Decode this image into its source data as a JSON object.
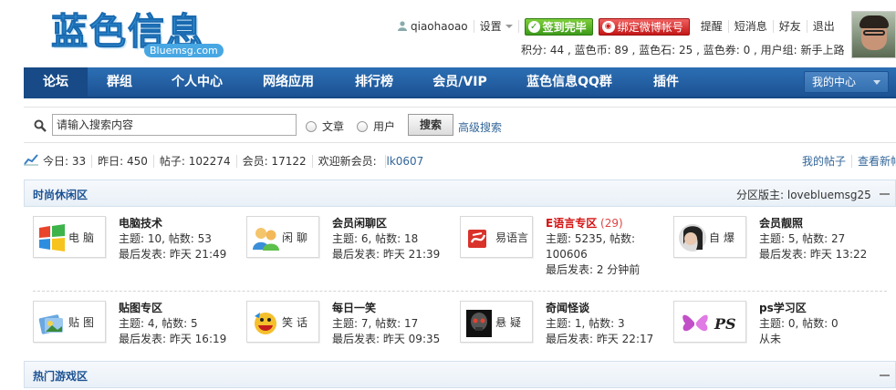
{
  "logo": {
    "text": "蓝色信息",
    "sub": "Bluemsg.com"
  },
  "userbar": {
    "username": "qiaohaoao",
    "settings": "设置",
    "sign_label": "签到完毕",
    "weibo_label": "绑定微博帐号",
    "remind": "提醒",
    "messages": "短消息",
    "friends": "好友",
    "logout": "退出"
  },
  "credits": "积分: 44 , 蓝色币: 89 , 蓝色石: 25 , 蓝色券: 0 , 用户组: 新手上路",
  "nav": {
    "items": [
      "论坛",
      "群组",
      "个人中心",
      "网络应用",
      "排行榜",
      "会员/VIP",
      "蓝色信息QQ群",
      "插件"
    ],
    "my_center": "我的中心"
  },
  "search": {
    "placeholder": "请输入搜索内容",
    "opt_article": "文章",
    "opt_user": "用户",
    "button": "搜索",
    "advanced": "高级搜索"
  },
  "stats": {
    "today": "今日: 33",
    "yesterday": "昨日: 450",
    "posts": "帖子: 102274",
    "members": "会员: 17122",
    "welcome_prefix": "欢迎新会员: ",
    "newest": "lk0607",
    "my_posts": "我的帖子",
    "view_new": "查看新帖"
  },
  "sections": [
    {
      "title": "时尚休闲区",
      "moderator": "分区版主: lovebluemsg25",
      "forums": [
        {
          "icon_label": "电脑",
          "icon": "windows-icon",
          "name": "电脑技术",
          "count": "",
          "topics": "主题: 10, 帖数: 53",
          "last": "最后发表: 昨天 21:49"
        },
        {
          "icon_label": "闲聊",
          "icon": "chat-people-icon",
          "name": "会员闲聊区",
          "count": "",
          "topics": "主题: 6, 帖数: 18",
          "last": "最后发表: 昨天 21:39"
        },
        {
          "icon_label": "易语言",
          "icon": "e-language-icon",
          "name": "E语言专区",
          "count": "(29)",
          "topics": "主题: 5235, 帖数: 100606",
          "last": "最后发表: 2 分钟前"
        },
        {
          "icon_label": "自爆",
          "icon": "portrait-icon",
          "name": "会员靓照",
          "count": "",
          "topics": "主题: 5, 帖数: 27",
          "last": "最后发表: 昨天 13:22"
        },
        {
          "icon_label": "贴图",
          "icon": "photo-icon",
          "name": "贴图专区",
          "count": "",
          "topics": "主题: 4, 帖数: 5",
          "last": "最后发表: 昨天 16:19"
        },
        {
          "icon_label": "笑话",
          "icon": "laugh-icon",
          "name": "每日一笑",
          "count": "",
          "topics": "主题: 7, 帖数: 17",
          "last": "最后发表: 昨天 09:35"
        },
        {
          "icon_label": "悬疑",
          "icon": "skull-icon",
          "name": "奇闻怪谈",
          "count": "",
          "topics": "主题: 1, 帖数: 3",
          "last": "最后发表: 昨天 22:17"
        },
        {
          "icon_label": "",
          "icon": "ps-butterfly-icon",
          "name": "ps学习区",
          "count": "",
          "topics": "主题: 0, 帖数: 0",
          "last": "从未"
        }
      ]
    },
    {
      "title": "热门游戏区"
    }
  ],
  "colors": {
    "nav": "#1c5293",
    "accent_red": "#d41212",
    "link": "#336699"
  }
}
